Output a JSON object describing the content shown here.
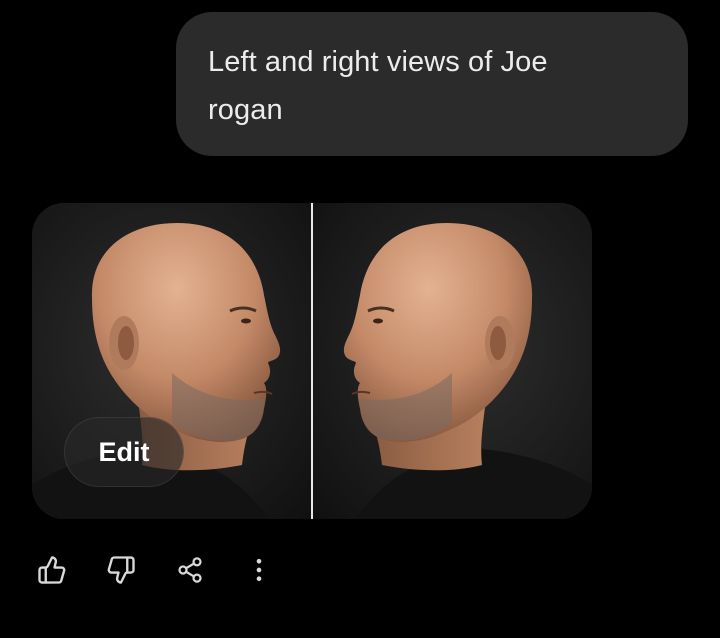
{
  "user_message": {
    "text": "Left and right views of Joe rogan",
    "line1": "Left and right views of Joe",
    "line2": "rogan"
  },
  "image_result": {
    "edit_label": "Edit",
    "panels": [
      "left-profile-view",
      "right-profile-view"
    ]
  },
  "actions": {
    "items": [
      {
        "icon": "thumbs-up-icon"
      },
      {
        "icon": "thumbs-down-icon"
      },
      {
        "icon": "share-icon"
      },
      {
        "icon": "more-vertical-icon"
      }
    ]
  },
  "colors": {
    "background": "#000000",
    "bubble": "#2b2b2b",
    "bubble_text": "#ececec",
    "icon": "#d9d9d9",
    "divider": "#e8e8e8"
  }
}
